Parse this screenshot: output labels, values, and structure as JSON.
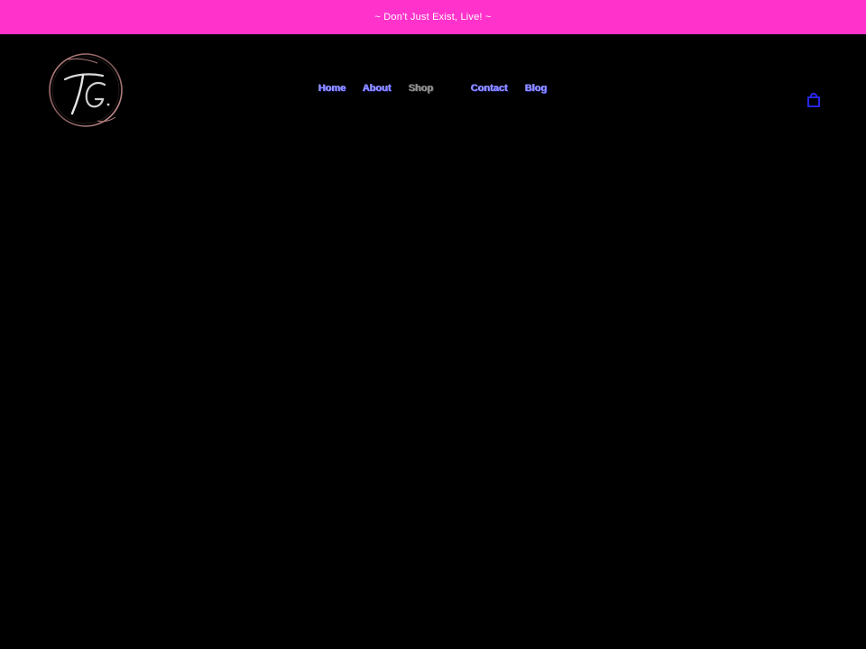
{
  "announcement": {
    "text": "~ Don't Just Exist, Live! ~"
  },
  "header": {
    "logo": {
      "monogram": "TG",
      "icon": "brand-logo-monogram"
    },
    "nav": [
      {
        "label": "Home"
      },
      {
        "label": "About"
      },
      {
        "label": "Shop"
      },
      {
        "label": "Contact"
      },
      {
        "label": "Blog"
      }
    ],
    "cart": {
      "icon": "shopping-bag-icon"
    }
  },
  "colors": {
    "announcement_bg": "#ff33cc",
    "page_bg": "#000000",
    "nav_link": "#8f8fff",
    "nav_link_muted": "#8a8a8a",
    "cart_icon": "#2a2aff"
  }
}
